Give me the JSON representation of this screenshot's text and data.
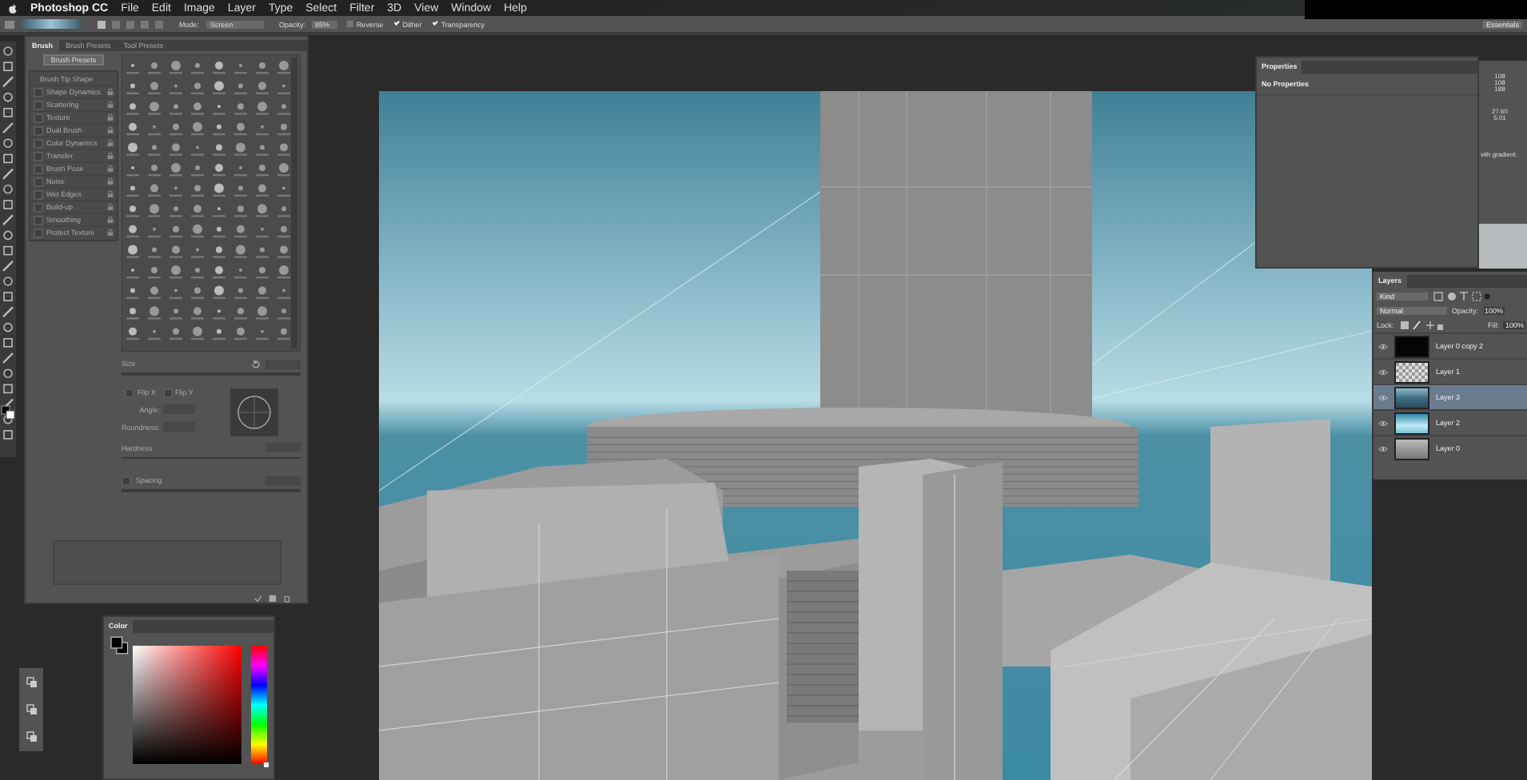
{
  "menu_bar": {
    "app": "Photoshop CC",
    "items": [
      "File",
      "Edit",
      "Image",
      "Layer",
      "Type",
      "Select",
      "Filter",
      "3D",
      "View",
      "Window",
      "Help"
    ]
  },
  "options_bar": {
    "mode_label": "Mode:",
    "mode": "Screen",
    "opacity_label": "Opacity:",
    "opacity": "85%",
    "options": [
      {
        "label": "Reverse",
        "checked": false
      },
      {
        "label": "Dither",
        "checked": true
      },
      {
        "label": "Transparency",
        "checked": true
      }
    ],
    "workspace": "Essentials"
  },
  "brush_panel": {
    "tabs": [
      {
        "label": "Brush",
        "selected": true
      },
      {
        "label": "Brush Presets",
        "selected": false
      },
      {
        "label": "Tool Presets",
        "selected": false
      }
    ],
    "presets_button": "Brush Presets",
    "tip_shape": "Brush Tip Shape",
    "settings": [
      {
        "label": "Shape Dynamics",
        "checked": false
      },
      {
        "label": "Scattering",
        "checked": false
      },
      {
        "label": "Texture",
        "checked": false
      },
      {
        "label": "Dual Brush",
        "checked": false
      },
      {
        "label": "Color Dynamics",
        "checked": false
      },
      {
        "label": "Transfer",
        "checked": false
      },
      {
        "label": "Brush Pose",
        "checked": false
      },
      {
        "label": "Noise",
        "checked": false
      },
      {
        "label": "Wet Edges",
        "checked": false
      },
      {
        "label": "Build-up",
        "checked": false
      },
      {
        "label": "Smoothing",
        "checked": false
      },
      {
        "label": "Protect Texture",
        "checked": false
      }
    ],
    "size_label": "Size",
    "flips": [
      {
        "label": "Flip X",
        "checked": false
      },
      {
        "label": "Flip Y",
        "checked": false
      }
    ],
    "angle_label": "Angle:",
    "roundness_label": "Roundness:",
    "hardness_label": "Hardness",
    "spacing": {
      "label": "Spacing",
      "checked": false
    }
  },
  "properties_panel": {
    "title": "Properties",
    "message": "No Properties"
  },
  "info_panel": {
    "values": [
      "108",
      "108",
      "188",
      "27.60",
      "5.01"
    ],
    "note": "vith gradient."
  },
  "layers_panel": {
    "title": "Layers",
    "filter": "Kind",
    "blend_mode": "Normal",
    "opacity_label": "Opacity:",
    "opacity": "100%",
    "lock_label": "Lock:",
    "fill_label": "Fill:",
    "fill": "100%",
    "layers": [
      {
        "name": "Layer 0 copy 2",
        "selected": false,
        "kind": "black"
      },
      {
        "name": "Layer 1",
        "selected": false,
        "kind": "checker"
      },
      {
        "name": "Layer 3",
        "selected": true,
        "kind": "sky"
      },
      {
        "name": "Layer 2",
        "selected": false,
        "kind": "blue"
      },
      {
        "name": "Layer 0",
        "selected": false,
        "kind": "gray"
      }
    ]
  },
  "color_panel": {
    "title": "Color",
    "hue_slider": {
      "level": 0
    }
  }
}
